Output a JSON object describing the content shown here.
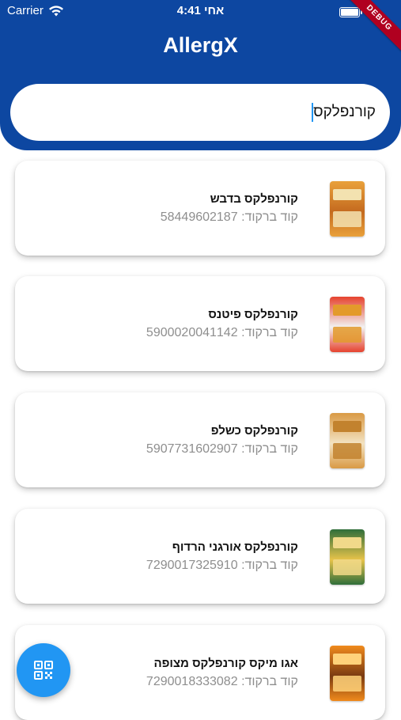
{
  "status_bar": {
    "carrier": "Carrier",
    "time": "4:41 אחי"
  },
  "debug_banner": "DEBUG",
  "app_title": "AllergX",
  "search": {
    "value": "קורנפלקס"
  },
  "barcode_prefix": "קוד ברקוד:",
  "products": [
    {
      "name": "קורנפלקס בדבש",
      "barcode": "58449602187",
      "colors": [
        "#e9a13b",
        "#c46a1f",
        "#f3e2b0"
      ]
    },
    {
      "name": "קורנפלקס פיטנס",
      "barcode": "5900020041142",
      "colors": [
        "#e6432e",
        "#f2f2f2",
        "#e39a2b"
      ]
    },
    {
      "name": "קורנפלקס כשלפ",
      "barcode": "5907731602907",
      "colors": [
        "#d99a45",
        "#f3e3c2",
        "#c2822e"
      ]
    },
    {
      "name": "קורנפלקס אורגני הרדוף",
      "barcode": "7290017325910",
      "colors": [
        "#2f6e3a",
        "#e7c34a",
        "#f1d98a"
      ]
    },
    {
      "name": "אגו מיקס קורנפלקס מצופה",
      "barcode": "7290018333082",
      "colors": [
        "#f08a1c",
        "#7a3b12",
        "#ffd27a"
      ]
    }
  ],
  "icons": {
    "wifi": "wifi-icon",
    "battery": "battery-icon",
    "scan": "qr-scan-icon"
  },
  "theme": {
    "primary": "#0d47a1",
    "fab": "#2196f3"
  }
}
